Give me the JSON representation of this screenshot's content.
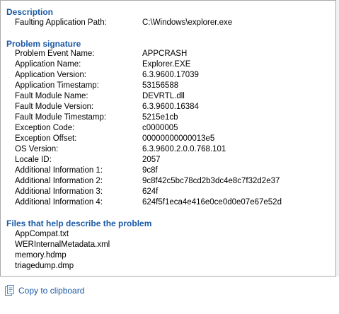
{
  "description": {
    "header": "Description",
    "rows": [
      {
        "key": "Faulting Application Path:",
        "value": "C:\\Windows\\explorer.exe"
      }
    ]
  },
  "problem_signature": {
    "header": "Problem signature",
    "rows": [
      {
        "key": "Problem Event Name:",
        "value": "APPCRASH"
      },
      {
        "key": "Application Name:",
        "value": "Explorer.EXE"
      },
      {
        "key": "Application Version:",
        "value": "6.3.9600.17039"
      },
      {
        "key": "Application Timestamp:",
        "value": "53156588"
      },
      {
        "key": "Fault Module Name:",
        "value": "DEVRTL.dll"
      },
      {
        "key": "Fault Module Version:",
        "value": "6.3.9600.16384"
      },
      {
        "key": "Fault Module Timestamp:",
        "value": "5215e1cb"
      },
      {
        "key": "Exception Code:",
        "value": "c0000005"
      },
      {
        "key": "Exception Offset:",
        "value": "00000000000013e5"
      },
      {
        "key": "OS Version:",
        "value": "6.3.9600.2.0.0.768.101"
      },
      {
        "key": "Locale ID:",
        "value": "2057"
      },
      {
        "key": "Additional Information 1:",
        "value": "9c8f"
      },
      {
        "key": "Additional Information 2:",
        "value": "9c8f42c5bc78cd2b3dc4e8c7f32d2e37"
      },
      {
        "key": "Additional Information 3:",
        "value": "624f"
      },
      {
        "key": "Additional Information 4:",
        "value": "624f5f1eca4e416e0ce0d0e07e67e52d"
      }
    ]
  },
  "files": {
    "header": "Files that help describe the problem",
    "items": [
      "AppCompat.txt",
      "WERInternalMetadata.xml",
      "memory.hdmp",
      "triagedump.dmp"
    ]
  },
  "footer": {
    "copy_label": "Copy to clipboard",
    "copy_icon": "clipboard-icon"
  },
  "colors": {
    "header_blue": "#1a5aa6",
    "link_blue": "#1a5aa6"
  }
}
